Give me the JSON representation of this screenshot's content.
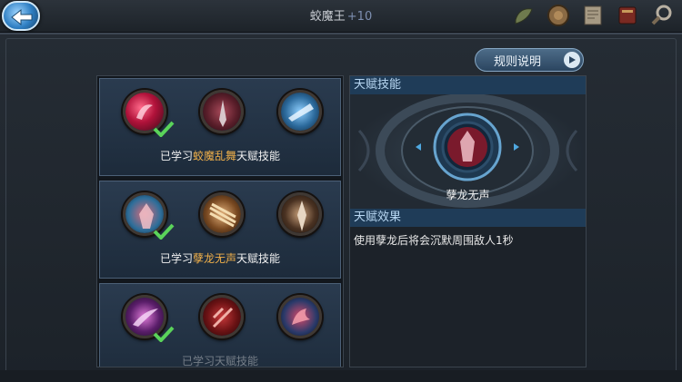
{
  "header": {
    "title": "蛟魔王",
    "level_suffix": "+10",
    "back_icon": "back-arrow-icon",
    "icons": [
      "scroll-icon",
      "shield-icon",
      "map-icon",
      "book-icon",
      "magnifier-icon"
    ]
  },
  "rules_button": {
    "label": "规则说明"
  },
  "talent_rows": [
    {
      "caption_prefix": "已学习",
      "skill_name": "蛟魔乱舞",
      "caption_suffix": "天赋技能",
      "skills": [
        {
          "name": "蛟魔乱舞",
          "learned": true
        },
        {
          "name": "sword-skill",
          "learned": false
        },
        {
          "name": "blade-skill",
          "learned": false
        }
      ]
    },
    {
      "caption_prefix": "已学习",
      "skill_name": "孽龙无声",
      "caption_suffix": "天赋技能",
      "skills": [
        {
          "name": "孽龙无声",
          "learned": true
        },
        {
          "name": "claw-skill",
          "learned": false
        },
        {
          "name": "spear-skill",
          "learned": false
        }
      ]
    },
    {
      "caption_prefix": "已学习",
      "skill_name": "",
      "caption_suffix": "天赋技能",
      "skills": [
        {
          "name": "slash-skill",
          "learned": true
        },
        {
          "name": "blood-skill",
          "learned": false
        },
        {
          "name": "dragon-skill",
          "learned": false
        }
      ]
    }
  ],
  "detail": {
    "skill_header": "天赋技能",
    "selected_skill_name": "孽龙无声",
    "effect_header": "天赋效果",
    "effect_text": "使用孽龙后将会沉默周围敌人1秒"
  },
  "colors": {
    "highlight": "#f1b04a",
    "check": "#5ad35a",
    "section_header_bg": "#1f3c58"
  }
}
